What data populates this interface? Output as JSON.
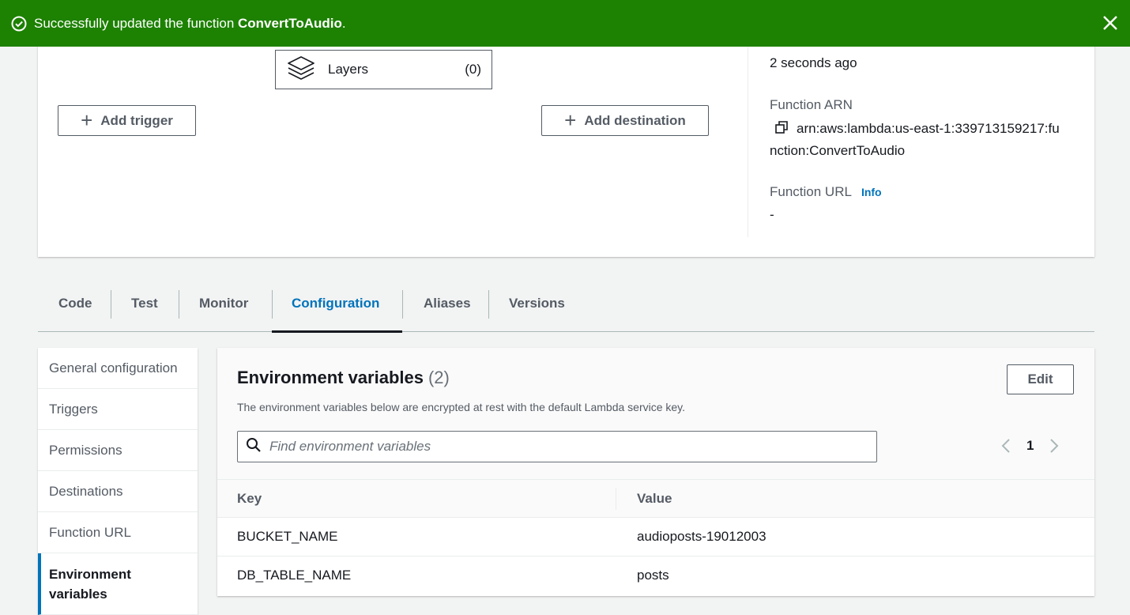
{
  "flash": {
    "message_prefix": "Successfully updated the function ",
    "function_name": "ConvertToAudio",
    "message_suffix": ".",
    "color": "#1d8102"
  },
  "overview": {
    "layers_label": "Layers",
    "layers_count": "(0)",
    "add_trigger_label": "Add trigger",
    "add_destination_label": "Add destination",
    "last_modified": "2 seconds ago",
    "arn_label": "Function ARN",
    "arn_line1": "arn:aws:lambda:us-east-1:339713159217:fu",
    "arn_line2": "nction:ConvertToAudio",
    "url_label": "Function URL",
    "info_link": "Info",
    "url_value": "-"
  },
  "tabs": [
    {
      "label": "Code"
    },
    {
      "label": "Test"
    },
    {
      "label": "Monitor"
    },
    {
      "label": "Configuration"
    },
    {
      "label": "Aliases"
    },
    {
      "label": "Versions"
    }
  ],
  "sidenav": {
    "items": [
      {
        "label": "General configuration"
      },
      {
        "label": "Triggers"
      },
      {
        "label": "Permissions"
      },
      {
        "label": "Destinations"
      },
      {
        "label": "Function URL"
      },
      {
        "label": "Environment variables"
      }
    ]
  },
  "env": {
    "title": "Environment variables",
    "count": "(2)",
    "description": "The environment variables below are encrypted at rest with the default Lambda service key.",
    "edit_label": "Edit",
    "search_placeholder": "Find environment variables",
    "page": "1",
    "columns": {
      "key": "Key",
      "value": "Value"
    },
    "rows": [
      {
        "key": "BUCKET_NAME",
        "value": "audioposts-19012003"
      },
      {
        "key": "DB_TABLE_NAME",
        "value": "posts"
      }
    ]
  },
  "colors": {
    "accent_blue": "#0073bb",
    "text_dark": "#16191f",
    "text_muted": "#545b64"
  }
}
